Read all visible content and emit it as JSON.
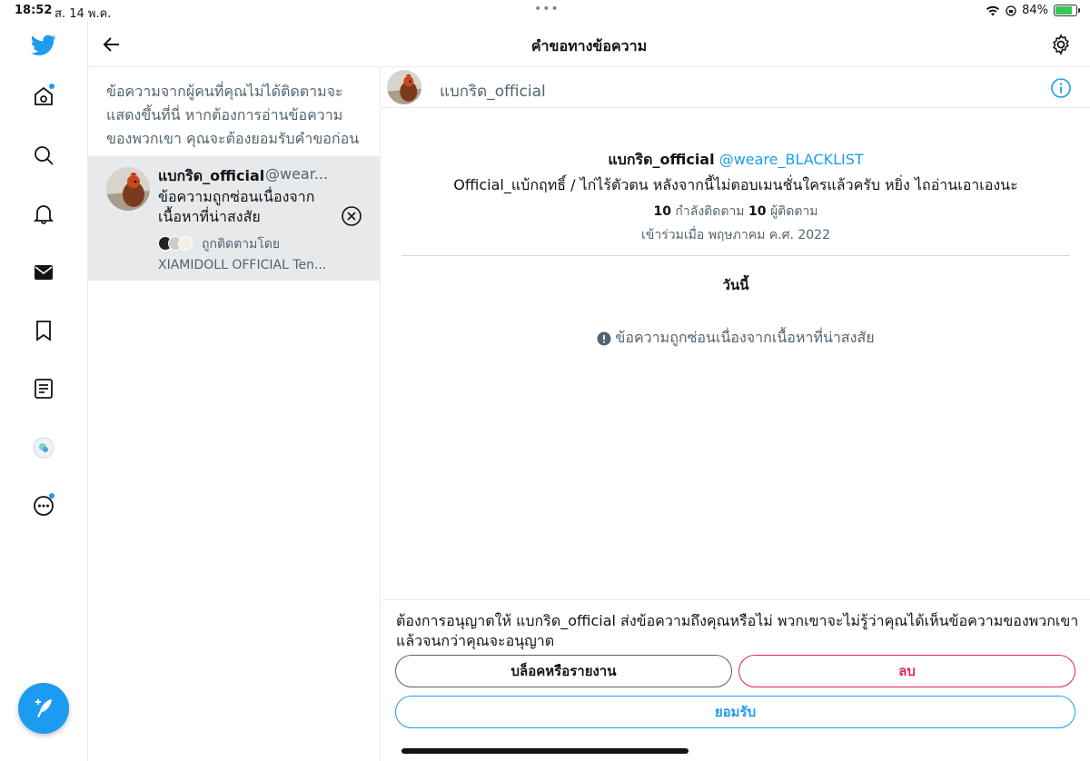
{
  "status_bar": {
    "time": "18:52",
    "date": "ส. 14 พ.ค.",
    "dots": "•••",
    "battery": "84%",
    "battery_level": 0.84
  },
  "rail": {
    "items": [
      "twitter-logo",
      "home-icon",
      "search-icon",
      "notifications-icon",
      "messages-icon",
      "bookmarks-icon",
      "lists-icon",
      "spaces-icon",
      "more-icon"
    ],
    "compose": "compose-icon"
  },
  "header": {
    "title": "คำขอทางข้อความ"
  },
  "requests": {
    "notice": "ข้อความจากผู้คนที่คุณไม่ได้ติดตามจะแสดงขึ้นที่นี่ หากต้องการอ่านข้อความของพวกเขา คุณจะต้องยอมรับคำขอก่อน",
    "items": [
      {
        "name": "แบกริด_official",
        "handle": "@wear...",
        "message": "ข้อความถูกซ่อนเนื่องจากเนื้อหาที่น่าสงสัย",
        "followed_by": "ถูกติดตามโดย",
        "followers": "XIAMIDOLL OFFICIAL Ten..."
      }
    ]
  },
  "chat": {
    "header_name": "แบกริด_official",
    "profile": {
      "name": "แบกริด_official",
      "handle": "@weare_BLACKLIST",
      "bio": "Official_แบ้กฤทธิ์ / ไก่ไร้ตัวตน หลังจากนี้ไม่ตอบเมนชั่นใครแล้วครับ หยิ่ง ไถอ่านเอาเองนะ",
      "following_count": "10",
      "following_label": "กำลังติดตาม",
      "followers_count": "10",
      "followers_label": "ผู้ติดตาม",
      "joined": "เข้าร่วมเมื่อ พฤษภาคม ค.ศ. 2022"
    },
    "day_label": "วันนี้",
    "hidden_message": "ข้อความถูกซ่อนเนื่องจากเนื้อหาที่น่าสงสัย",
    "footer_text": "ต้องการอนุญาตให้ แบกริด_official ส่งข้อความถึงคุณหรือไม่ พวกเขาจะไม่รู้ว่าคุณได้เห็นข้อความของพวกเขาแล้วจนกว่าคุณจะอนุญาต",
    "buttons": {
      "block": "บล็อคหรือรายงาน",
      "delete": "ลบ",
      "accept": "ยอมรับ"
    }
  },
  "colors": {
    "accent": "#1d9bf0",
    "danger": "#e0245e",
    "selected_row": "#e7e9ea"
  }
}
